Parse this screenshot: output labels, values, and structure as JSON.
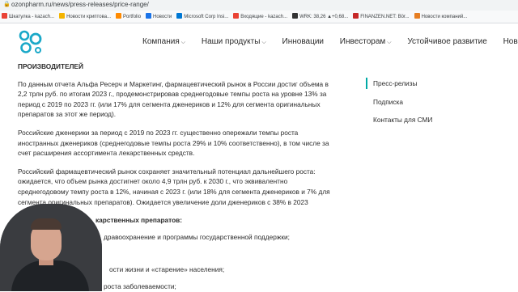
{
  "browser": {
    "url": "ozonpharm.ru/news/press-releases/price-range/",
    "bookmarks": [
      {
        "label": "Шкатулка - kazach...",
        "color": "#e94235"
      },
      {
        "label": "Новости криптова...",
        "color": "#f4b400"
      },
      {
        "label": "Portfolio",
        "color": "#ff8a00"
      },
      {
        "label": "Новости",
        "color": "#1a73e8"
      },
      {
        "label": "Microsoft Corp Insi...",
        "color": "#0078d4"
      },
      {
        "label": "Входящие - kazach...",
        "color": "#ea4335"
      },
      {
        "label": "WRK: 38,26 ▲+0,68...",
        "color": "#333333"
      },
      {
        "label": "FINANZEN.NET: Bör...",
        "color": "#c62828"
      },
      {
        "label": "Новости компаний...",
        "color": "#e67e22"
      }
    ]
  },
  "nav": {
    "items": [
      "Компания",
      "Наши продукты",
      "Инновации",
      "Инвесторам",
      "Устойчивое развитие",
      "Новости"
    ],
    "has_dropdown": [
      true,
      true,
      false,
      true,
      false,
      true
    ]
  },
  "article": {
    "heading": "ПРОИЗВОДИТЕЛЕЙ",
    "p1": "По данным отчета Альфа Ресерч и Маркетинг, фармацевтический рынок в России достиг объема в 2,2 трлн руб. по итогам 2023 г., продемонстрировав среднегодовые темпы роста на уровне 13% за период с 2019 по 2023 гг. (или 17% для сегмента дженериков и 12% для сегмента оригинальных препаратов за этот же период).",
    "p2": "Российские дженерики за период с 2019 по 2023 гг. существенно опережали темпы роста иностранных дженериков (среднегодовые темпы роста 29% и 10% соответственно), в том числе за счет расширения ассортимента лекарственных средств.",
    "p3": "Российский фармацевтический рынок сохраняет значительный потенциал дальнейшего роста: ожидается, что объем рынка достигнет около 4,9 трлн руб. к 2030 г., что эквивалентно среднегодовому темпу роста в 12%, начиная с 2023 г. (или 18% для сегмента дженериков и 7% для сегмента оригинальных препаратов). Ожидается увеличение доли дженериков с 38% в 2023",
    "list_heading": "карственных препаратов:",
    "list_1": "дравоохранение и программы государственной поддержки;",
    "list_2": "ости жизни и «старение» населения;",
    "list_3": "роста заболеваемости;"
  },
  "sidebar": {
    "items": [
      "Пресс-релизы",
      "Подписка",
      "Контакты для СМИ"
    ],
    "active_color": "#00a9a5"
  },
  "brand": {
    "logo_color": "#1aa8c8"
  }
}
